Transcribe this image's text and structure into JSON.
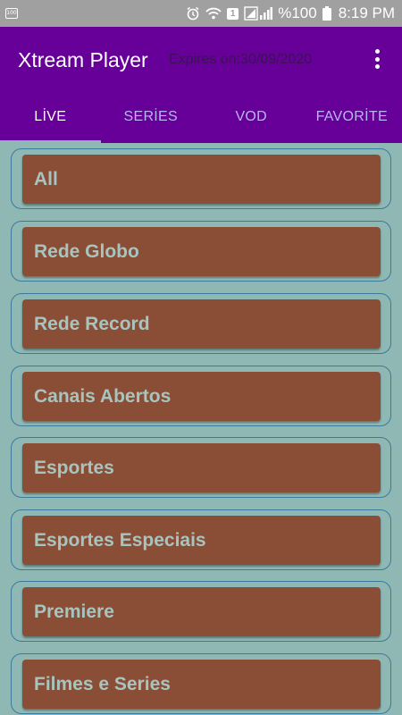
{
  "status_bar": {
    "notification_icon": "100",
    "battery": "%100",
    "time": "8:19 PM",
    "sim_label": "1",
    "icons": [
      "alarm-icon",
      "wifi-icon",
      "sim-icon",
      "signal-icon",
      "battery-icon"
    ]
  },
  "app_bar": {
    "title": "Xtream Player",
    "expiry": "Expires on:30/09/2020",
    "menu_icon": "more-vert-icon"
  },
  "tabs": [
    {
      "label": "LİVE",
      "active": true
    },
    {
      "label": "SERİES",
      "active": false
    },
    {
      "label": "VOD",
      "active": false
    },
    {
      "label": "FAVORİTE",
      "active": false
    }
  ],
  "categories": [
    {
      "label": "All"
    },
    {
      "label": "Rede Globo"
    },
    {
      "label": "Rede Record"
    },
    {
      "label": "Canais Abertos"
    },
    {
      "label": "Esportes"
    },
    {
      "label": "Esportes Especiais"
    },
    {
      "label": "Premiere"
    },
    {
      "label": "Filmes e Series"
    }
  ],
  "colors": {
    "app_bar": "#660099",
    "background": "#8fb8b4",
    "item_fill": "#8a4d36",
    "item_text": "#a8c4bf",
    "tab_inactive": "#b6b6f0"
  }
}
